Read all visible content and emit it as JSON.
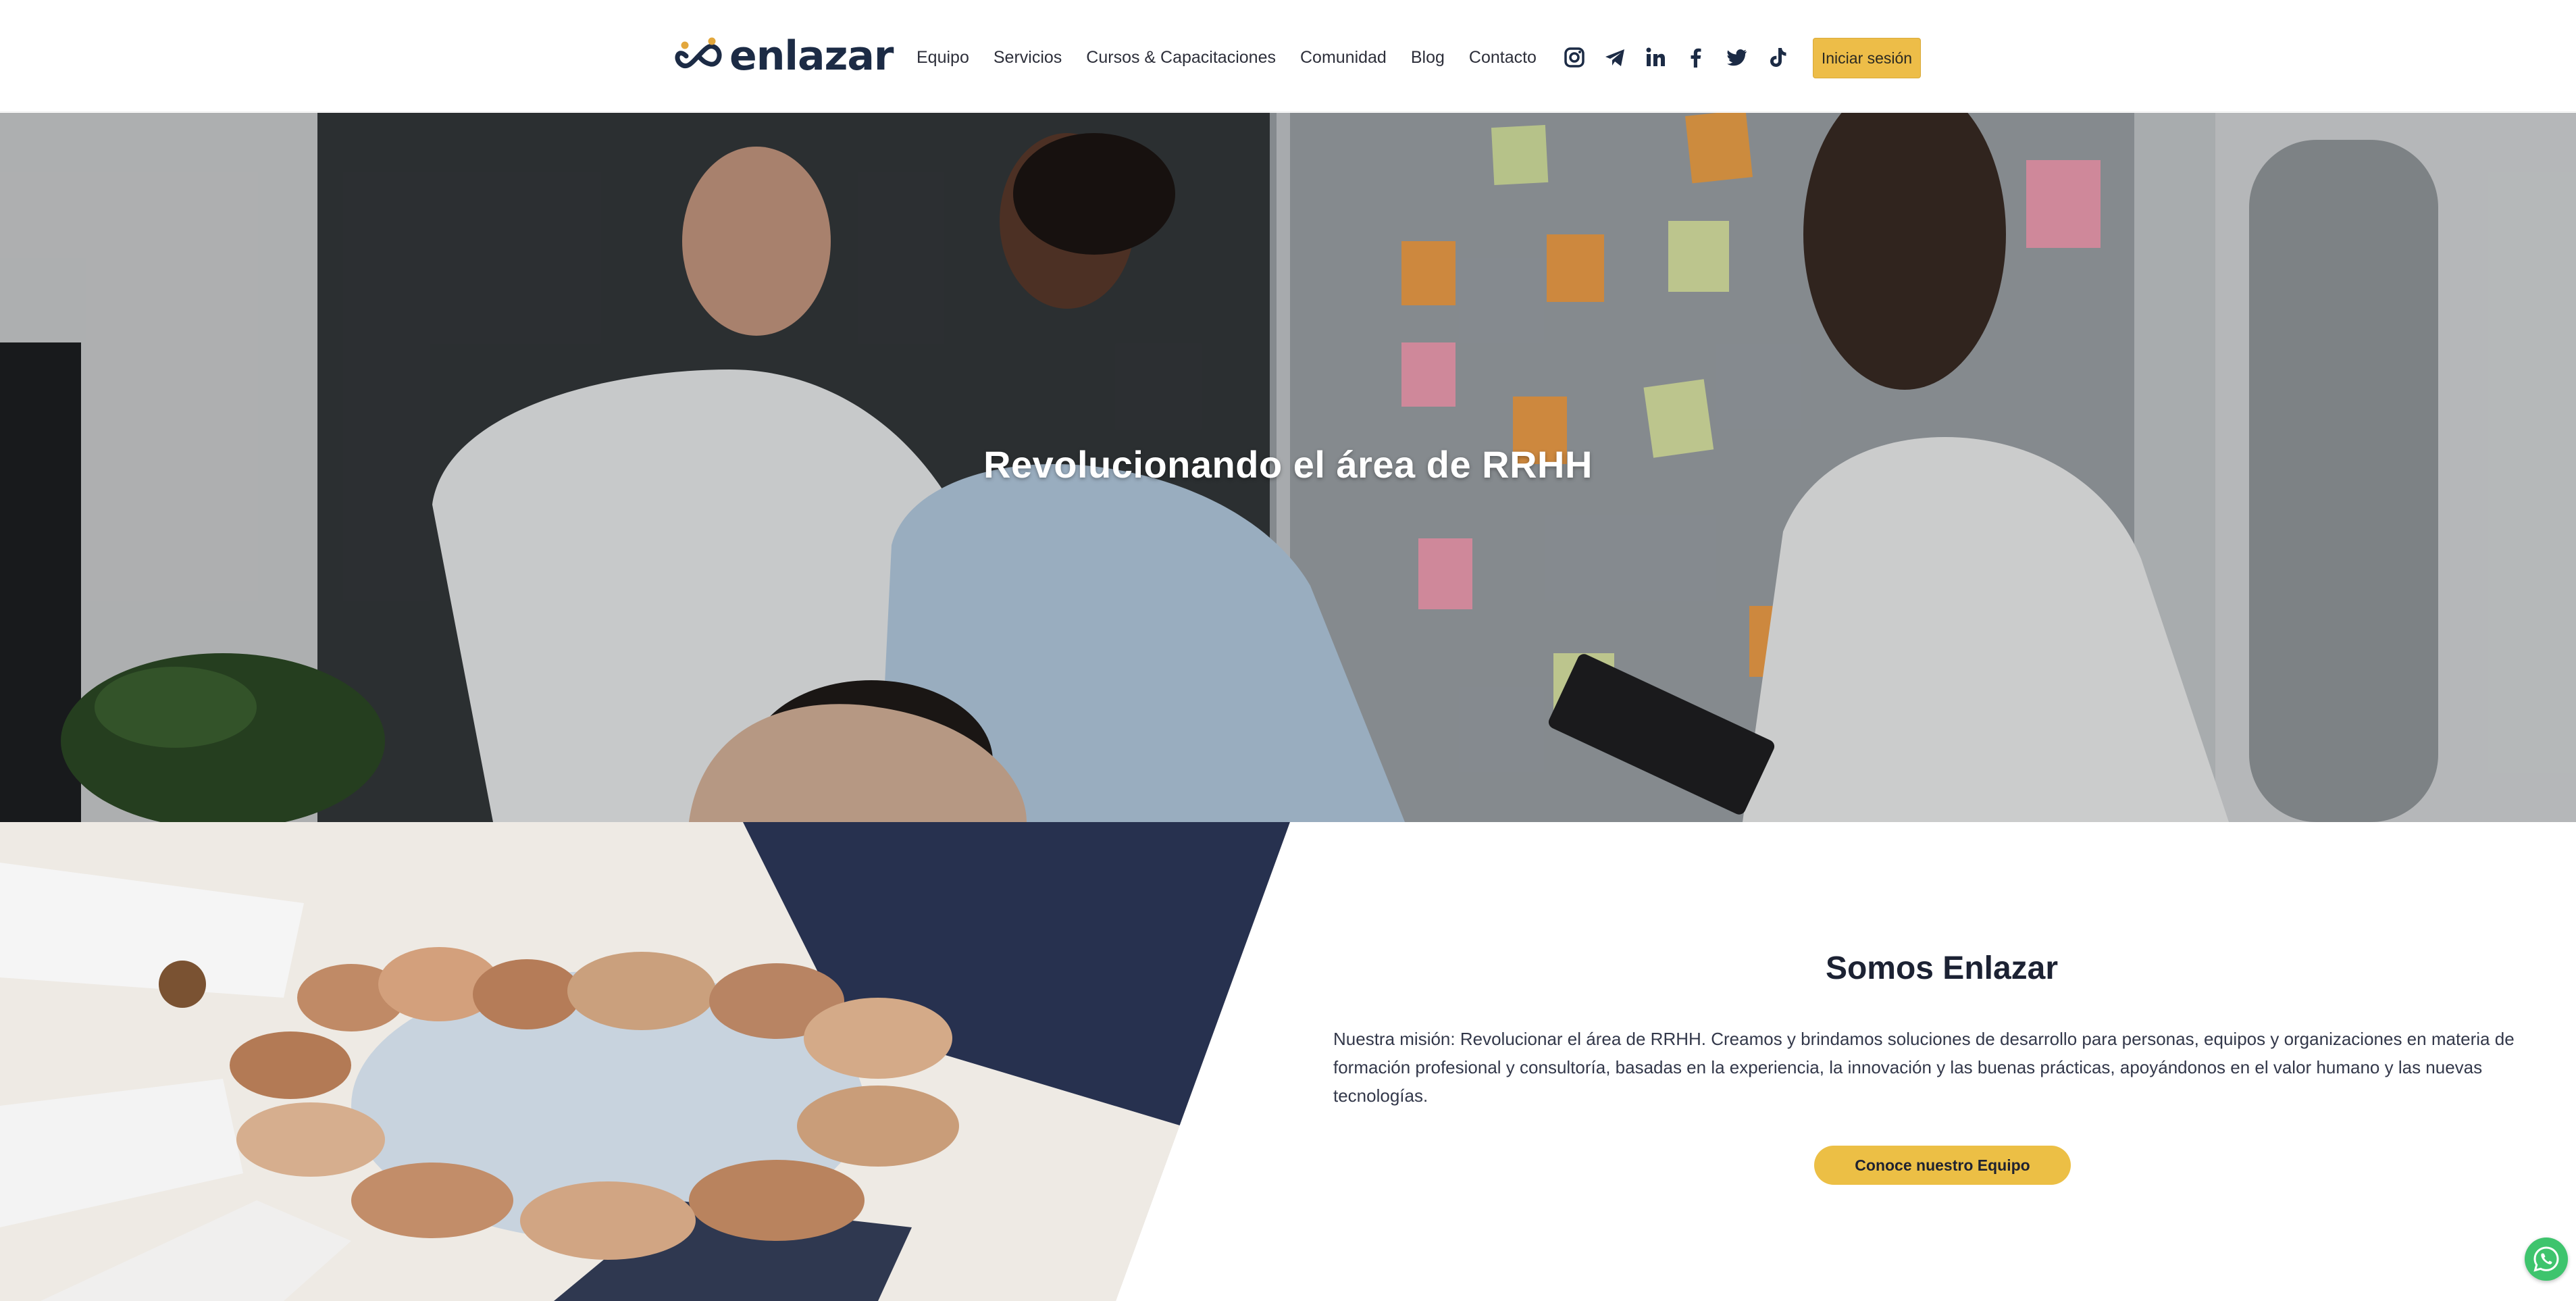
{
  "brand": {
    "name": "enlazar",
    "logo_icon": "infinity-people-logo",
    "colors": {
      "navy": "#1c2b45",
      "accent": "#edbd48",
      "whatsapp": "#3ec46d"
    }
  },
  "nav": {
    "items": [
      {
        "label": "Equipo"
      },
      {
        "label": "Servicios"
      },
      {
        "label": "Cursos & Capacitaciones"
      },
      {
        "label": "Comunidad"
      },
      {
        "label": "Blog"
      },
      {
        "label": "Contacto"
      }
    ]
  },
  "socials": [
    {
      "icon": "instagram-icon"
    },
    {
      "icon": "telegram-icon"
    },
    {
      "icon": "linkedin-icon"
    },
    {
      "icon": "facebook-icon"
    },
    {
      "icon": "twitter-icon"
    },
    {
      "icon": "tiktok-icon"
    }
  ],
  "header": {
    "login_label": "Iniciar sesión"
  },
  "hero": {
    "title": "Revolucionando el área de RRHH",
    "image": "team-brainstorming-sticky-notes-photo"
  },
  "mission": {
    "image": "hands-joined-circle-photo",
    "title": "Somos Enlazar",
    "text": "Nuestra misión: Revolucionar el área de RRHH. Creamos y brindamos soluciones de desarrollo para personas, equipos y organizaciones en materia de formación profesional y consultoría, basadas en la experiencia, la innovación y las buenas prácticas, apoyándonos en el valor humano y las nuevas tecnologías.",
    "cta_label": "Conoce nuestro Equipo"
  },
  "whatsapp": {
    "icon": "whatsapp-icon"
  }
}
